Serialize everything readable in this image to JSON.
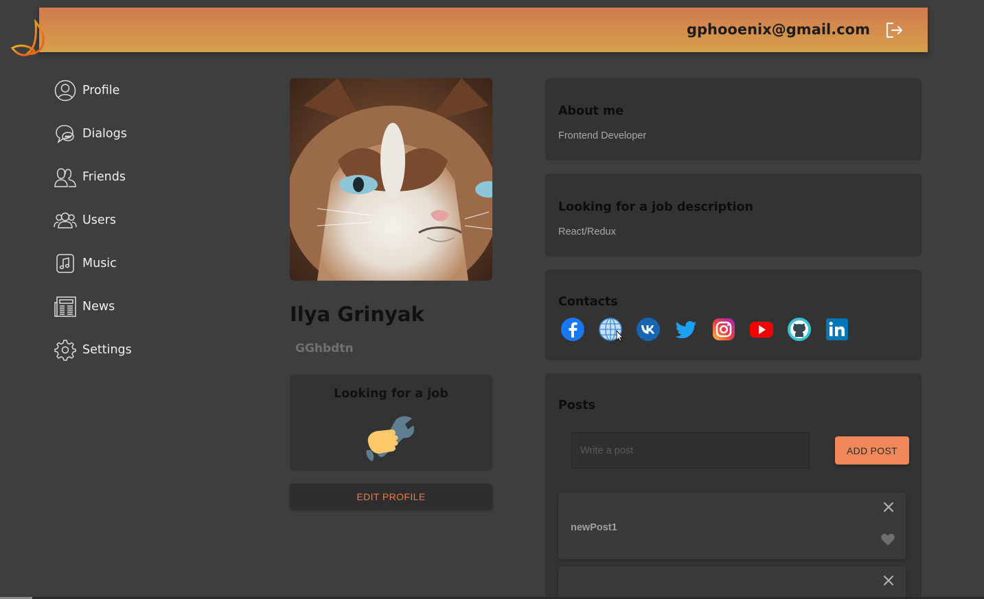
{
  "header": {
    "email": "gphooenix@gmail.com",
    "brand_color": "#d6a04a"
  },
  "nav": {
    "items": [
      {
        "label": "Profile",
        "icon": "profile-icon"
      },
      {
        "label": "Dialogs",
        "icon": "dialogs-icon"
      },
      {
        "label": "Friends",
        "icon": "friends-icon"
      },
      {
        "label": "Users",
        "icon": "users-icon"
      },
      {
        "label": "Music",
        "icon": "music-icon"
      },
      {
        "label": "News",
        "icon": "news-icon"
      },
      {
        "label": "Settings",
        "icon": "settings-icon"
      }
    ]
  },
  "profile": {
    "full_name": "Ilya Grinyak",
    "status": "GGhbdtn",
    "job_card_title": "Looking for a job",
    "edit_button": "EDIT PROFILE"
  },
  "about": {
    "title": "About me",
    "text": "Frontend Developer"
  },
  "job_description": {
    "title": "Looking for a job description",
    "text": "React/Redux"
  },
  "contacts": {
    "title": "Contacts",
    "items": [
      "facebook-icon",
      "website-icon",
      "vk-icon",
      "twitter-icon",
      "instagram-icon",
      "youtube-icon",
      "github-icon",
      "linkedin-icon"
    ]
  },
  "posts": {
    "title": "Posts",
    "input_placeholder": "Write a post",
    "input_value": "",
    "add_button": "ADD POST",
    "items": [
      {
        "message": "newPost1"
      },
      {
        "message": ""
      }
    ]
  },
  "colors": {
    "accent": "#f0885a",
    "background": "#3e3e3e",
    "card": "#333333"
  }
}
